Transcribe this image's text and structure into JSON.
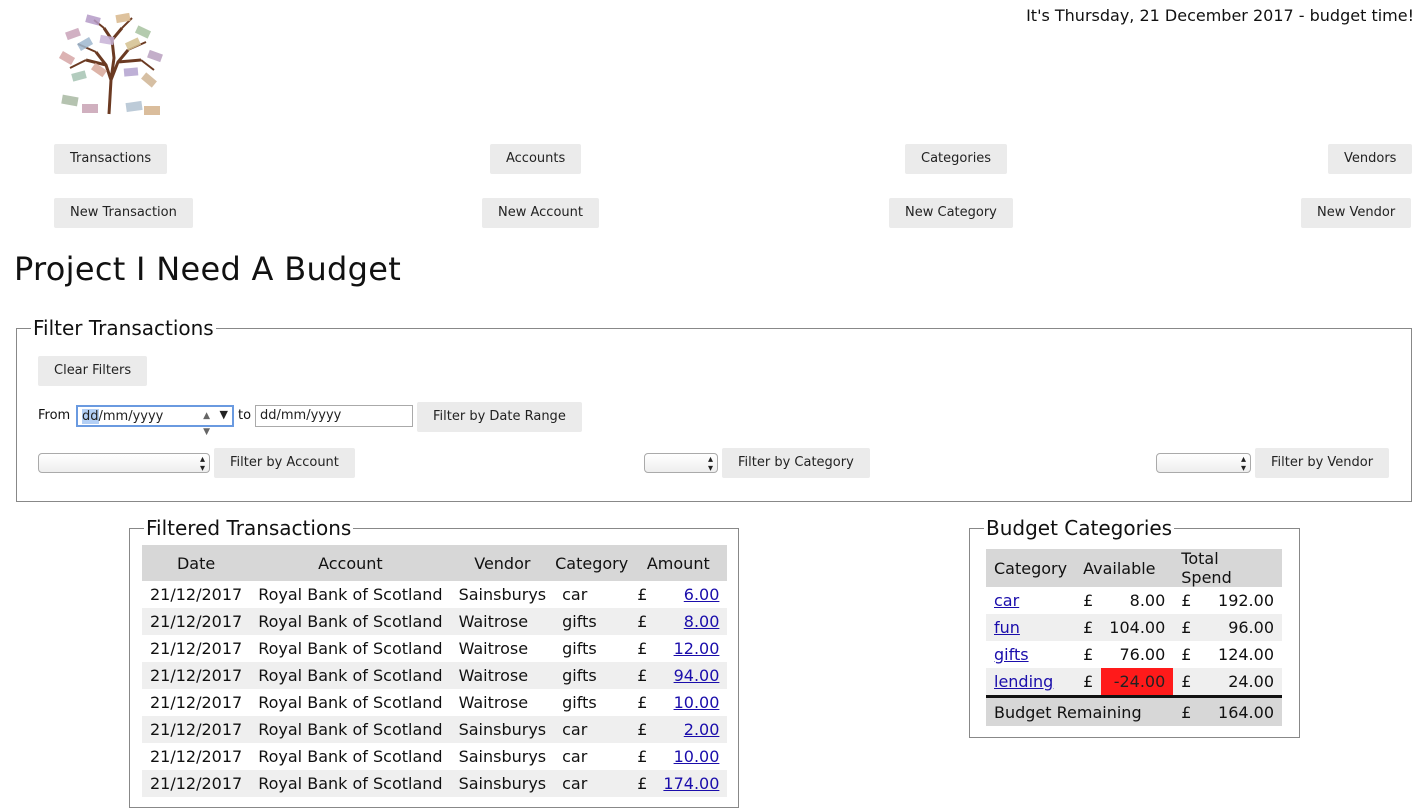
{
  "header": {
    "date_line": "It's Thursday, 21 December 2017 - budget time!",
    "logo_icon": "money-tree-icon"
  },
  "nav": {
    "transactions": "Transactions",
    "accounts": "Accounts",
    "categories": "Categories",
    "vendors": "Vendors",
    "new_transaction": "New Transaction",
    "new_account": "New Account",
    "new_category": "New Category",
    "new_vendor": "New Vendor"
  },
  "page_title": "Project I Need A Budget",
  "filters": {
    "legend": "Filter Transactions",
    "clear_label": "Clear Filters",
    "from_label": "From",
    "to_label": "to",
    "from_value": "dd/mm/yyyy",
    "to_value": "dd/mm/yyyy",
    "date_button": "Filter by Date Range",
    "account_button": "Filter by Account",
    "category_button": "Filter by Category",
    "vendor_button": "Filter by Vendor"
  },
  "transactions": {
    "legend": "Filtered Transactions",
    "columns": [
      "Date",
      "Account",
      "Vendor",
      "Category",
      "Amount"
    ],
    "currency": "£",
    "rows": [
      {
        "date": "21/12/2017",
        "account": "Royal Bank of Scotland",
        "vendor": "Sainsburys",
        "category": "car",
        "amount": "6.00"
      },
      {
        "date": "21/12/2017",
        "account": "Royal Bank of Scotland",
        "vendor": "Waitrose",
        "category": "gifts",
        "amount": "8.00"
      },
      {
        "date": "21/12/2017",
        "account": "Royal Bank of Scotland",
        "vendor": "Waitrose",
        "category": "gifts",
        "amount": "12.00"
      },
      {
        "date": "21/12/2017",
        "account": "Royal Bank of Scotland",
        "vendor": "Waitrose",
        "category": "gifts",
        "amount": "94.00"
      },
      {
        "date": "21/12/2017",
        "account": "Royal Bank of Scotland",
        "vendor": "Waitrose",
        "category": "gifts",
        "amount": "10.00"
      },
      {
        "date": "21/12/2017",
        "account": "Royal Bank of Scotland",
        "vendor": "Sainsburys",
        "category": "car",
        "amount": "2.00"
      },
      {
        "date": "21/12/2017",
        "account": "Royal Bank of Scotland",
        "vendor": "Sainsburys",
        "category": "car",
        "amount": "10.00"
      },
      {
        "date": "21/12/2017",
        "account": "Royal Bank of Scotland",
        "vendor": "Sainsburys",
        "category": "car",
        "amount": "174.00"
      }
    ]
  },
  "budget": {
    "legend": "Budget Categories",
    "columns": [
      "Category",
      "Available",
      "Total Spend"
    ],
    "currency": "£",
    "rows": [
      {
        "category": "car",
        "available": "8.00",
        "spend": "192.00",
        "negative": false
      },
      {
        "category": "fun",
        "available": "104.00",
        "spend": "96.00",
        "negative": false
      },
      {
        "category": "gifts",
        "available": "76.00",
        "spend": "124.00",
        "negative": false
      },
      {
        "category": "lending",
        "available": "-24.00",
        "spend": "24.00",
        "negative": true
      }
    ],
    "remaining_label": "Budget Remaining",
    "remaining_value": "164.00",
    "negative_color": "#ff1a1a"
  }
}
